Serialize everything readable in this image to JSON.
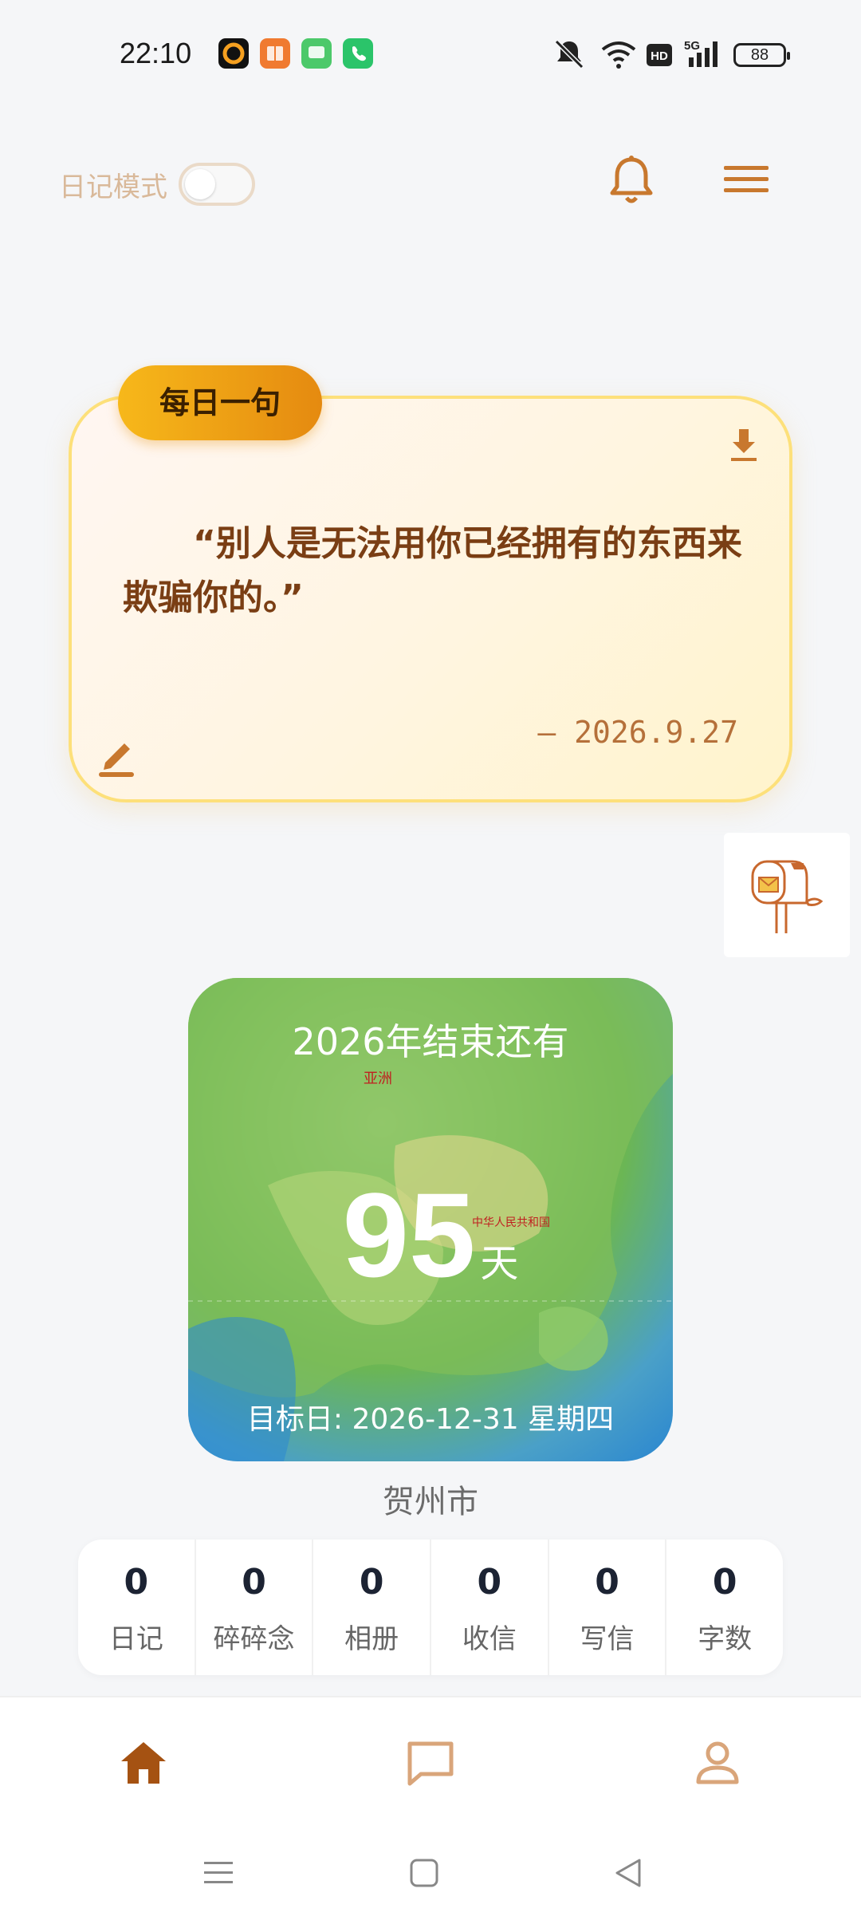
{
  "status_bar": {
    "time": "22:10",
    "battery": "88",
    "icons": [
      "camera-app-icon",
      "books-app-icon",
      "messages-app-icon",
      "phone-app-icon",
      "mute-icon",
      "wifi-icon",
      "hd-icon",
      "5g-signal-icon"
    ]
  },
  "header": {
    "diary_mode_label": "日记模式",
    "diary_mode_on": false
  },
  "quote_card": {
    "badge": "每日一句",
    "text": "“别人是无法用你已经拥有的东西来欺骗你的。”",
    "date": "— 2026.9.27"
  },
  "countdown": {
    "title": "2026年结束还有",
    "number": "95",
    "unit": "天",
    "target": "目标日: 2026-12-31 星期四",
    "map_label_region": "亚洲",
    "map_label_country": "中华人民共和国"
  },
  "city": "贺州市",
  "stats": [
    {
      "value": "0",
      "label": "日记"
    },
    {
      "value": "0",
      "label": "碎碎念"
    },
    {
      "value": "0",
      "label": "相册"
    },
    {
      "value": "0",
      "label": "收信"
    },
    {
      "value": "0",
      "label": "写信"
    },
    {
      "value": "0",
      "label": "字数"
    }
  ],
  "colors": {
    "accent": "#b5703a",
    "nav_active": "#a55212",
    "badge_start": "#f7b81a",
    "badge_end": "#e58a10"
  }
}
